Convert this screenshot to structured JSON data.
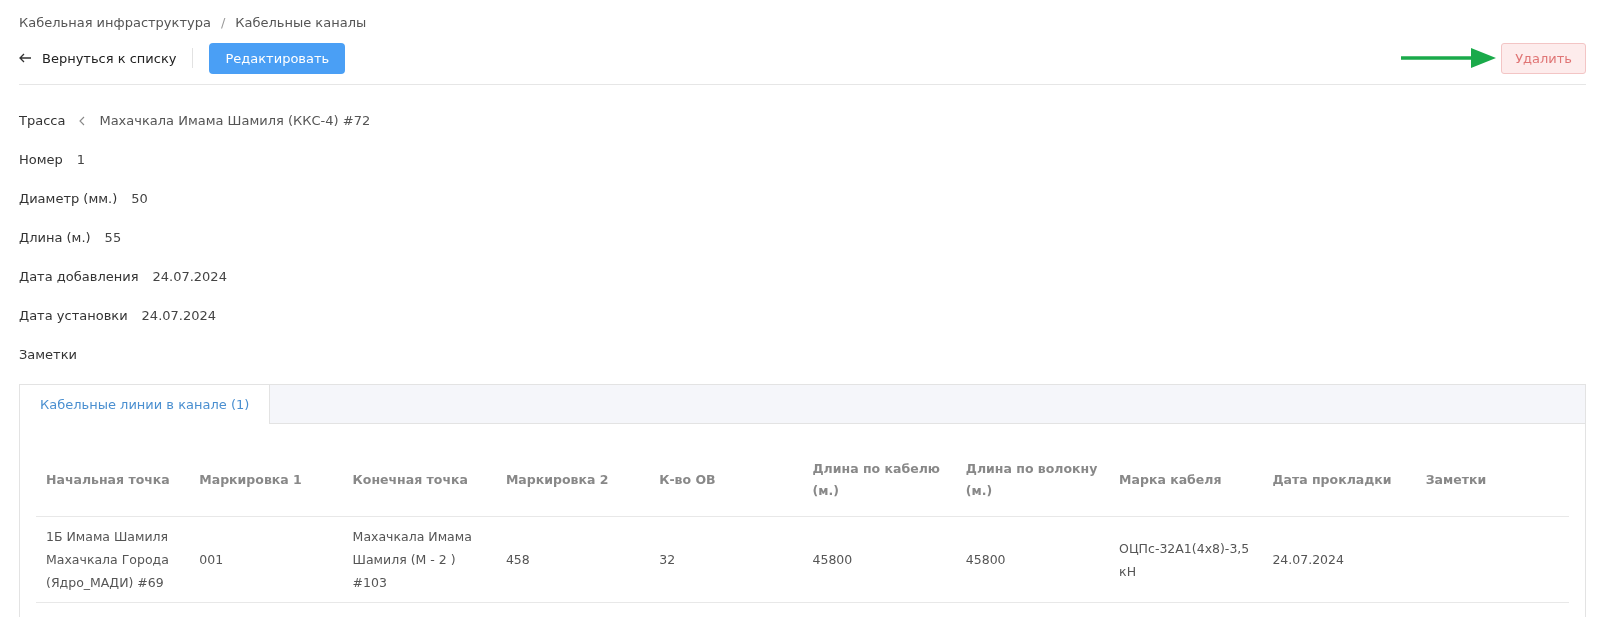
{
  "breadcrumbs": [
    "Кабельная инфраструктура",
    "Кабельные каналы"
  ],
  "breadcrumb_separator": "/",
  "toolbar": {
    "back": "Вернуться к списку",
    "edit": "Редактировать",
    "delete": "Удалить"
  },
  "fields": [
    {
      "kind": "link",
      "label": "Трасса",
      "value": "Махачкала Имама Шамиля (ККС-4) #72"
    },
    {
      "kind": "text",
      "label": "Номер",
      "value": "1"
    },
    {
      "kind": "text",
      "label": "Диаметр (мм.)",
      "value": "50"
    },
    {
      "kind": "text",
      "label": "Длина (м.)",
      "value": "55"
    },
    {
      "kind": "text",
      "label": "Дата добавления",
      "value": "24.07.2024"
    },
    {
      "kind": "text",
      "label": "Дата установки",
      "value": "24.07.2024"
    },
    {
      "kind": "text",
      "label": "Заметки"
    }
  ],
  "tabs": [
    {
      "label": "Кабельные линии в канале (1)",
      "selected": true
    }
  ],
  "table": {
    "columns": [
      "Начальная точка",
      "Маркировка 1",
      "Конечная точка",
      "Маркировка 2",
      "К-во ОВ",
      "Длина по кабелю (м.)",
      "Длина по волокну (м.)",
      "Марка кабеля",
      "Дата прокладки",
      "Заметки"
    ],
    "rows": [
      [
        "1Б Имама Шамиля Махачкала Города (Ядро_МАДИ) #69",
        "001",
        "Махачкала Имама Шамиля (М - 2 ) #103",
        "458",
        "32",
        "45800",
        "45800",
        "ОЦПс-32А1(4х8)-3,5 кН",
        "24.07.2024",
        ""
      ]
    ]
  }
}
